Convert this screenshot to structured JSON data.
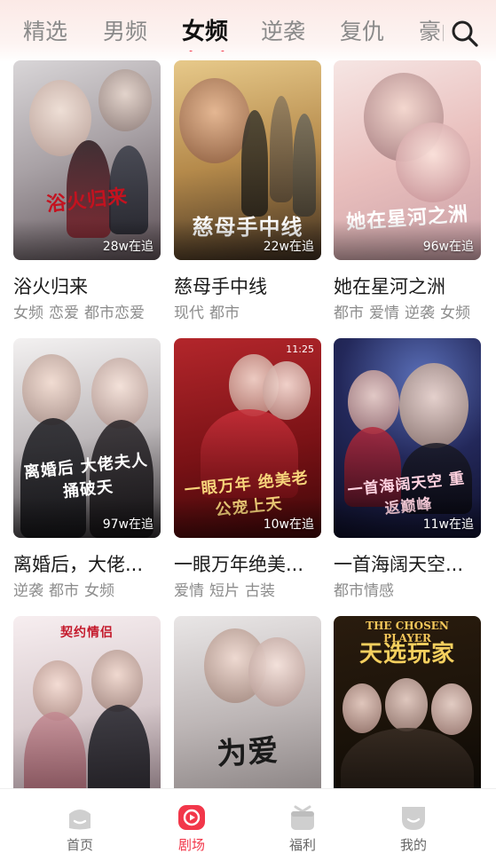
{
  "tabs": [
    {
      "label": "精选"
    },
    {
      "label": "男频"
    },
    {
      "label": "女频"
    },
    {
      "label": "逆袭"
    },
    {
      "label": "复仇"
    },
    {
      "label": "豪门"
    }
  ],
  "active_tab": "女频",
  "colors": {
    "accent": "#f2374a",
    "tab_inactive": "#8a8a8a",
    "tag_text": "#8c8c8c"
  },
  "dramas": [
    {
      "title": "浴火归来",
      "views": "28w在追",
      "tags": [
        "女频",
        "恋爱",
        "都市恋爱"
      ],
      "poster_text": "浴火归来"
    },
    {
      "title": "慈母手中线",
      "views": "22w在追",
      "tags": [
        "现代",
        "都市"
      ],
      "poster_text": "慈母手中线"
    },
    {
      "title": "她在星河之洲",
      "views": "96w在追",
      "tags": [
        "都市",
        "爱情",
        "逆袭",
        "女频"
      ],
      "poster_text": "她在星河之洲"
    },
    {
      "title": "离婚后，大佬...",
      "views": "97w在追",
      "tags": [
        "逆袭",
        "都市",
        "女频"
      ],
      "poster_text": "离婚后 大佬夫人 捅破天"
    },
    {
      "title": "一眼万年绝美...",
      "views": "10w在追",
      "tags": [
        "爱情",
        "短片",
        "古装"
      ],
      "poster_text": "一眼万年 绝美老公宠上天",
      "clock": "11:25"
    },
    {
      "title": "一首海阔天空...",
      "views": "11w在追",
      "tags": [
        "都市情感"
      ],
      "poster_text": "一首海阔天空 重返巅峰"
    },
    {
      "title": "",
      "views": "",
      "tags": [],
      "poster_text": "契约情侣"
    },
    {
      "title": "",
      "views": "",
      "tags": [],
      "poster_text": "为爱"
    },
    {
      "title": "",
      "views": "",
      "tags": [],
      "poster_text": "天选玩家",
      "poster_subtext": "THE CHOSEN PLAYER"
    }
  ],
  "bottom_nav": [
    {
      "label": "首页",
      "icon": "home-icon"
    },
    {
      "label": "剧场",
      "icon": "theater-play-icon"
    },
    {
      "label": "福利",
      "icon": "gift-icon"
    },
    {
      "label": "我的",
      "icon": "profile-icon"
    }
  ],
  "active_nav": "剧场"
}
